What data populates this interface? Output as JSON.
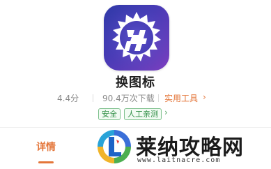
{
  "app": {
    "name": "换图标",
    "rating": "4.4分",
    "downloads": "90.4万次下载",
    "category": "实用工具",
    "category_chevron": "›",
    "icon": "app-logo-icon"
  },
  "badges": {
    "safe": "安全",
    "human_tested": "人工亲测",
    "chevron": "›"
  },
  "tabs": {
    "details": "详情"
  },
  "watermark": {
    "title": "莱纳攻略网",
    "url": "www.laitnacre.com",
    "logo": "watermark-logo"
  },
  "colors": {
    "accent": "#e4763a",
    "badge_green": "#2f8e45",
    "icon_gradient_start": "#2f3aa8",
    "icon_gradient_end": "#7d3fc0"
  }
}
